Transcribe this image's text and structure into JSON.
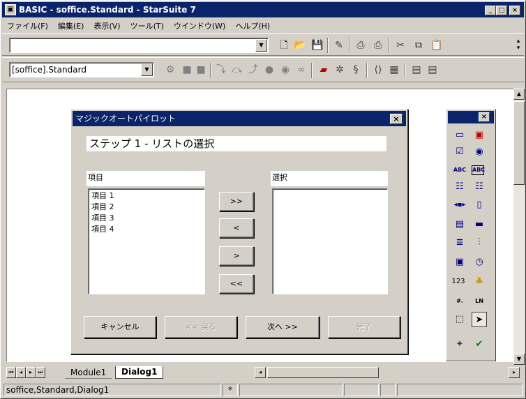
{
  "window": {
    "title": "BASIC - soffice.Standard - StarSuite 7",
    "minimize": "_",
    "maximize": "□",
    "close": "×"
  },
  "menu": [
    "ファイル(F)",
    "編集(E)",
    "表示(V)",
    "ツール(T)",
    "ウインドウ(W)",
    "ヘルプ(H)"
  ],
  "toolbar1": {
    "url_value": "",
    "icons": [
      "new-doc-icon",
      "open-folder-icon",
      "save-icon",
      "edit-icon",
      "print-preview-icon",
      "print-icon",
      "cut-icon",
      "copy-icon",
      "paste-icon"
    ]
  },
  "toolbar2": {
    "library_select": "[soffice].Standard",
    "icons": [
      "macro-icon",
      "stop-icon",
      "stop-icon",
      "step-into-icon",
      "step-over-icon",
      "step-out-icon",
      "breakpoint-icon",
      "watch-icon",
      "find-icon",
      "dialog-icon",
      "settings-icon",
      "library-icon",
      "brackets-icon",
      "catalog-icon",
      "import-icon",
      "export-icon"
    ]
  },
  "dialog": {
    "title": "マジックオートパイロット",
    "close": "×",
    "step_text": "ステップ 1 - リストの選択",
    "items_label": "項目",
    "selected_label": "選択",
    "items": [
      "項目 1",
      "項目 2",
      "項目 3",
      "項目 4"
    ],
    "btn_add_all": ">>",
    "btn_remove": "<",
    "btn_add": ">",
    "btn_remove_all": "<<",
    "btn_cancel": "キャンセル",
    "btn_back": "<< 戻る",
    "btn_next": "次へ >>",
    "btn_finish": "完了"
  },
  "toolbox": {
    "close": "×",
    "rows": [
      [
        "label-icon",
        "combobox-icon"
      ],
      [
        "checkbox-icon",
        "radio-icon"
      ],
      [
        "textfield-abc-icon",
        "fixed-text-icon"
      ],
      [
        "listbox-icon",
        "combo-icon"
      ],
      [
        "horizontal-scroll-icon",
        "vertical-scroll-icon"
      ],
      [
        "group-box-icon",
        "progress-bar-icon"
      ],
      [
        "list-icon",
        "separator-icon"
      ],
      [
        "date-field-icon",
        "time-field-icon"
      ],
      [
        "numeric-field-icon",
        "currency-field-icon"
      ],
      [
        "pattern-field-icon",
        "formatted-field-icon"
      ],
      [
        "select-icon",
        "pointer-icon"
      ],
      [
        "properties-icon",
        "activate-test-icon"
      ]
    ],
    "labels": {
      "numeric": "123",
      "abc1": "ABC",
      "abc2": "ABC",
      "ln": "LN",
      "pattern": "#."
    }
  },
  "tabs": {
    "module": "Module1",
    "dialog": "Dialog1"
  },
  "status": {
    "location": "soffice,Standard,Dialog1",
    "mark": "*"
  }
}
